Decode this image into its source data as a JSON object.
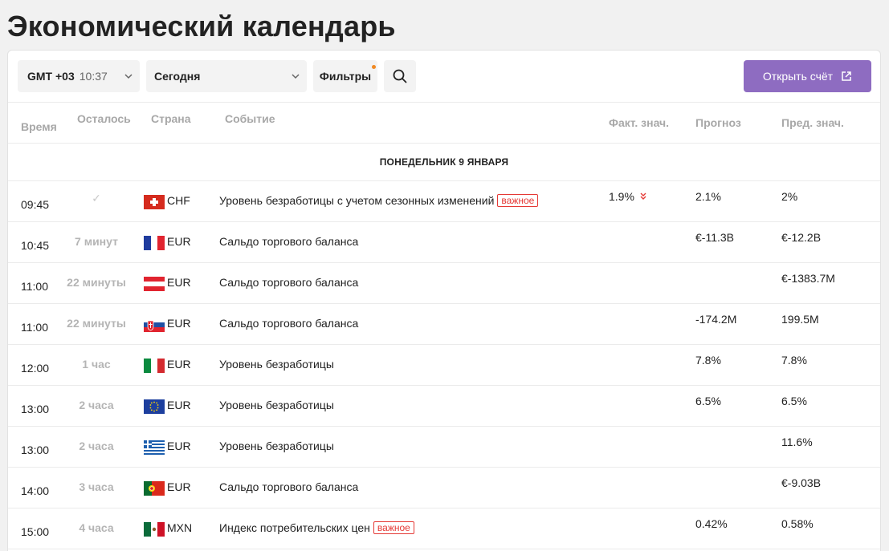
{
  "title": "Экономический календарь",
  "toolbar": {
    "timezone": "GMT +03",
    "clock": "10:37",
    "date": "Сегодня",
    "filters_label": "Фильтры",
    "open_account_label": "Открыть счёт"
  },
  "columns": {
    "time": "Время",
    "remaining": "Осталось",
    "country": "Страна",
    "event": "Событие",
    "actual": "Факт. знач.",
    "forecast": "Прогноз",
    "previous": "Пред. знач."
  },
  "day_label": "ПОНЕДЕЛЬНИК 9 ЯНВАРЯ",
  "important_label": "важное",
  "events": [
    {
      "time": "09:45",
      "remaining": "✓",
      "flag": "flag-switzerland",
      "currency": "CHF",
      "event": "Уровень безработицы с учетом сезонных изменений",
      "important": true,
      "actual": "1.9%",
      "actual_trend": "down",
      "forecast": "2.1%",
      "previous": "2%"
    },
    {
      "time": "10:45",
      "remaining": "7 минут",
      "flag": "flag-france",
      "currency": "EUR",
      "event": "Сальдо торгового баланса",
      "important": false,
      "actual": "",
      "forecast": "€-11.3B",
      "previous": "€-12.2B"
    },
    {
      "time": "11:00",
      "remaining": "22 минуты",
      "flag": "flag-austria",
      "currency": "EUR",
      "event": "Сальдо торгового баланса",
      "important": false,
      "actual": "",
      "forecast": "",
      "previous": "€-1383.7M"
    },
    {
      "time": "11:00",
      "remaining": "22 минуты",
      "flag": "flag-slovakia",
      "currency": "EUR",
      "event": "Сальдо торгового баланса",
      "important": false,
      "actual": "",
      "forecast": "-174.2M",
      "previous": "199.5M"
    },
    {
      "time": "12:00",
      "remaining": "1 час",
      "flag": "flag-italy",
      "currency": "EUR",
      "event": "Уровень безработицы",
      "important": false,
      "actual": "",
      "forecast": "7.8%",
      "previous": "7.8%"
    },
    {
      "time": "13:00",
      "remaining": "2 часа",
      "flag": "flag-eu",
      "currency": "EUR",
      "event": "Уровень безработицы",
      "important": false,
      "actual": "",
      "forecast": "6.5%",
      "previous": "6.5%"
    },
    {
      "time": "13:00",
      "remaining": "2 часа",
      "flag": "flag-greece",
      "currency": "EUR",
      "event": "Уровень безработицы",
      "important": false,
      "actual": "",
      "forecast": "",
      "previous": "11.6%"
    },
    {
      "time": "14:00",
      "remaining": "3 часа",
      "flag": "flag-portugal",
      "currency": "EUR",
      "event": "Сальдо торгового баланса",
      "important": false,
      "actual": "",
      "forecast": "",
      "previous": "€-9.03B"
    },
    {
      "time": "15:00",
      "remaining": "4 часа",
      "flag": "flag-mexico",
      "currency": "MXN",
      "event": "Индекс потребительских цен",
      "important": true,
      "actual": "",
      "forecast": "0.42%",
      "previous": "0.58%"
    }
  ],
  "colors": {
    "accent": "#8e6cc1",
    "important": "#e53935",
    "filters_dot": "#f08a24"
  }
}
